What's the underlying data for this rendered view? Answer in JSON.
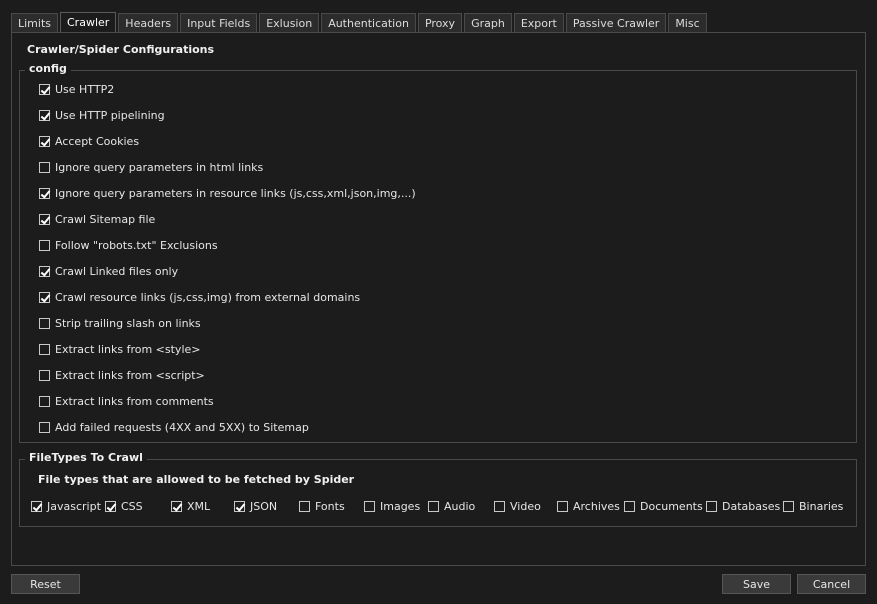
{
  "tabs": [
    "Limits",
    "Crawler",
    "Headers",
    "Input Fields",
    "Exlusion",
    "Authentication",
    "Proxy",
    "Graph",
    "Export",
    "Passive Crawler",
    "Misc"
  ],
  "active_tab": "Crawler",
  "panel_title": "Crawler/Spider Configurations",
  "config": {
    "title": "config",
    "options": [
      {
        "label": "Use HTTP2",
        "checked": true
      },
      {
        "label": "Use HTTP pipelining",
        "checked": true
      },
      {
        "label": "Accept Cookies",
        "checked": true
      },
      {
        "label": "Ignore query parameters in html links",
        "checked": false
      },
      {
        "label": "Ignore query parameters in resource links (js,css,xml,json,img,...)",
        "checked": true
      },
      {
        "label": "Crawl Sitemap file",
        "checked": true
      },
      {
        "label": "Follow \"robots.txt\" Exclusions",
        "checked": false
      },
      {
        "label": "Crawl Linked files only",
        "checked": true
      },
      {
        "label": "Crawl resource links (js,css,img) from external domains",
        "checked": true
      },
      {
        "label": "Strip trailing slash on links",
        "checked": false
      },
      {
        "label": "Extract links from <style>",
        "checked": false
      },
      {
        "label": "Extract links from <script>",
        "checked": false
      },
      {
        "label": "Extract links from comments",
        "checked": false
      },
      {
        "label": "Add failed requests (4XX and 5XX) to Sitemap",
        "checked": false
      }
    ]
  },
  "filetypes": {
    "title": "FileTypes To Crawl",
    "subtitle": "File types that are allowed to be fetched by Spider",
    "items": [
      {
        "label": "Javascript",
        "checked": true
      },
      {
        "label": "CSS",
        "checked": true
      },
      {
        "label": "XML",
        "checked": true
      },
      {
        "label": "JSON",
        "checked": true
      },
      {
        "label": "Fonts",
        "checked": false
      },
      {
        "label": "Images",
        "checked": false
      },
      {
        "label": "Audio",
        "checked": false
      },
      {
        "label": "Video",
        "checked": false
      },
      {
        "label": "Archives",
        "checked": false
      },
      {
        "label": "Documents",
        "checked": false
      },
      {
        "label": "Databases",
        "checked": false
      },
      {
        "label": "Binaries",
        "checked": false
      }
    ]
  },
  "buttons": {
    "reset": "Reset",
    "save": "Save",
    "cancel": "Cancel"
  }
}
